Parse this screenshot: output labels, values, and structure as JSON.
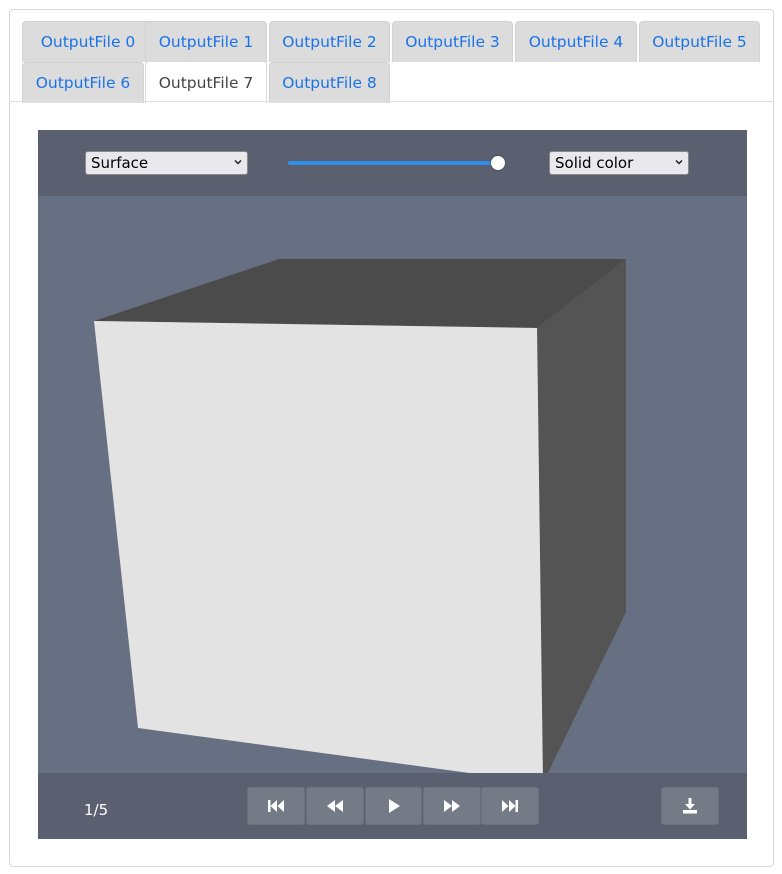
{
  "tabs": [
    {
      "label": "OutputFile 0"
    },
    {
      "label": "OutputFile 1"
    },
    {
      "label": "OutputFile 2"
    },
    {
      "label": "OutputFile 3"
    },
    {
      "label": "OutputFile 4"
    },
    {
      "label": "OutputFile 5"
    },
    {
      "label": "OutputFile 6"
    },
    {
      "label": "OutputFile 7"
    },
    {
      "label": "OutputFile 8"
    }
  ],
  "active_tab": "OutputFile 7",
  "viewer": {
    "representation": {
      "value": "Surface",
      "options_visible": [
        "Surface"
      ]
    },
    "coloring": {
      "value": "Solid color"
    },
    "opacity_slider": {
      "value": 1.0
    },
    "frame_counter": "1/5",
    "controls": {
      "first": "skip-back-icon",
      "previous": "rewind-icon",
      "play": "play-icon",
      "next": "fast-forward-icon",
      "last": "skip-forward-icon",
      "download": "download-icon"
    }
  },
  "colors": {
    "link": "#1a73e8",
    "toolbar": "#5b6070",
    "canvas": "#667082",
    "slider_fill": "#2f8ee8",
    "cube_front": "#e3e3e3",
    "cube_top": "#4b4b4b",
    "cube_side": "#545454"
  }
}
